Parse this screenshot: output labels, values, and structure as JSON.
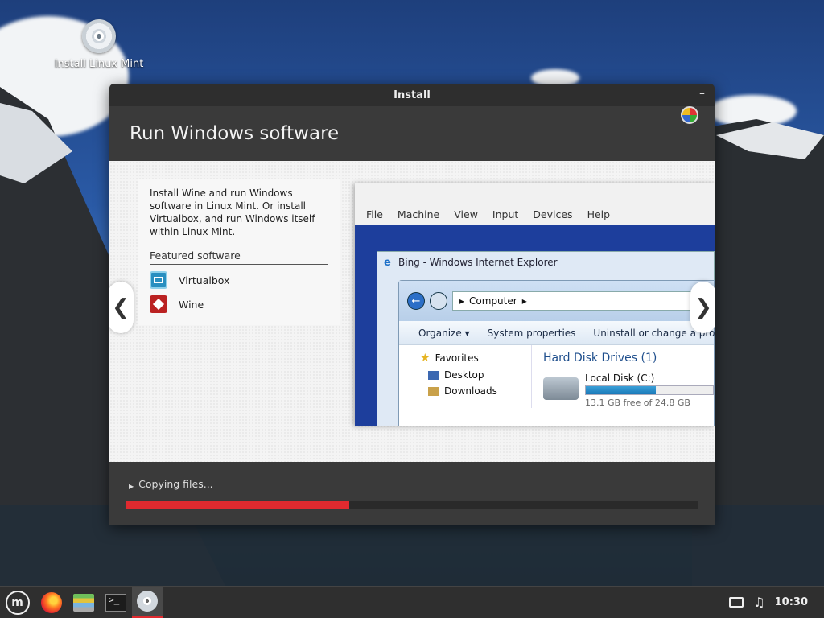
{
  "desktop": {
    "icon_label": "Install Linux Mint"
  },
  "window": {
    "title": "Install",
    "minimize_glyph": "–",
    "slide_title": "Run Windows software",
    "description": "Install Wine and run Windows software in Linux Mint. Or install Virtualbox, and run Windows itself within Linux Mint.",
    "featured_title": "Featured software",
    "featured_apps": [
      "Virtualbox",
      "Wine"
    ],
    "nav_prev": "❮",
    "nav_next": "❯",
    "status_text": "Copying files...",
    "progress_percent": 39
  },
  "screenshot": {
    "vbox_menu": [
      "File",
      "Machine",
      "View",
      "Input",
      "Devices",
      "Help"
    ],
    "ie_title": "Bing - Windows Internet Explorer",
    "address": "Computer",
    "toolbar": [
      "Organize ▾",
      "System properties",
      "Uninstall or change a program"
    ],
    "sidebar": [
      "Favorites",
      "Desktop",
      "Downloads"
    ],
    "drives_header": "Hard Disk Drives (1)",
    "disk_name": "Local Disk (C:)",
    "disk_free": "13.1 GB free of 24.8 GB"
  },
  "taskbar": {
    "clock": "10:30",
    "terminal_glyph": ">_"
  },
  "colors": {
    "accent": "#e02a2f",
    "window_bg": "#3a3a3a"
  }
}
